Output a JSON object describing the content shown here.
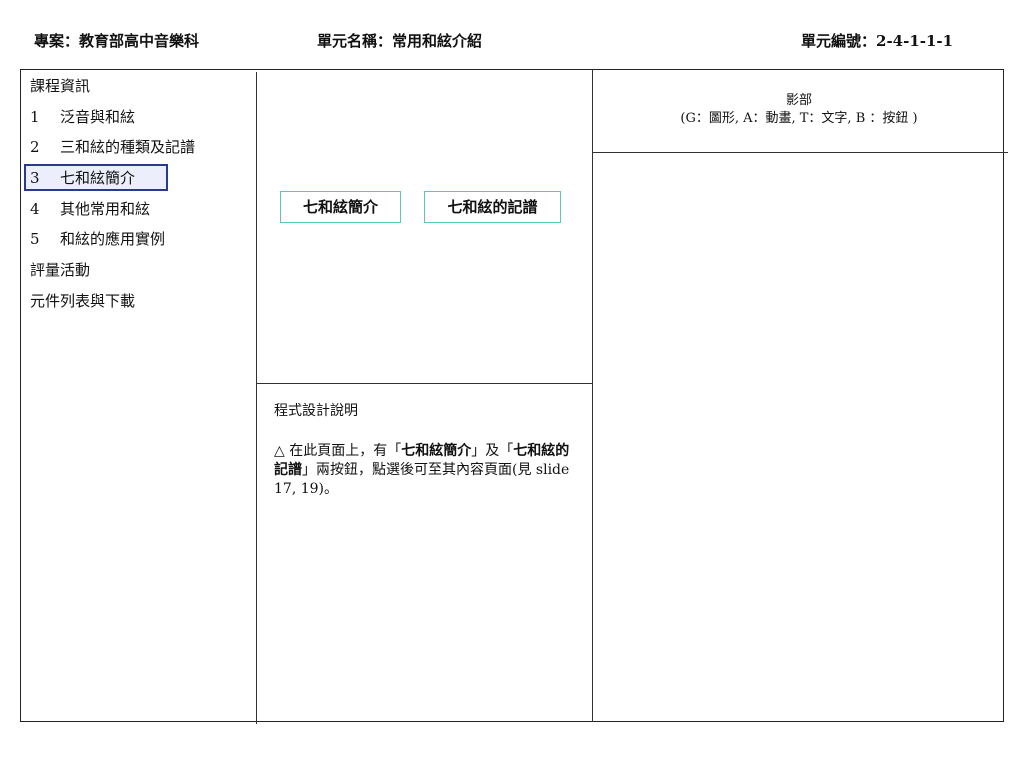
{
  "header": {
    "project": "專案：教育部高中音樂科",
    "unit_name": "單元名稱：常用和絃介紹",
    "unit_code": "單元編號：2-4-1-1-1"
  },
  "nav": {
    "items": [
      {
        "num": "",
        "label": "課程資訊"
      },
      {
        "num": "1",
        "label": "泛音與和絃"
      },
      {
        "num": "2",
        "label": "三和絃的種類及記譜"
      },
      {
        "num": "3",
        "label": "七和絃簡介",
        "active": true
      },
      {
        "num": "4",
        "label": "其他常用和絃"
      },
      {
        "num": "5",
        "label": "和絃的應用實例"
      },
      {
        "num": "",
        "label": "評量活動"
      },
      {
        "num": "",
        "label": "元件列表與下載"
      }
    ]
  },
  "buttons": {
    "intro_label": "七和絃簡介",
    "notation_label": "七和絃的記譜"
  },
  "description": {
    "title": "程式設計說明",
    "prefix": "△ 在此頁面上，有「",
    "bold1": "七和絃簡介",
    "mid": "」及「",
    "bold2": "七和絃的記譜",
    "suffix": "」兩按鈕，點選後可至其內容頁面(見 slide 17, 19)。"
  },
  "media": {
    "title": "影部",
    "legend": "(G：圖形, A：動畫, T：文字, B ：按鈕 )"
  }
}
